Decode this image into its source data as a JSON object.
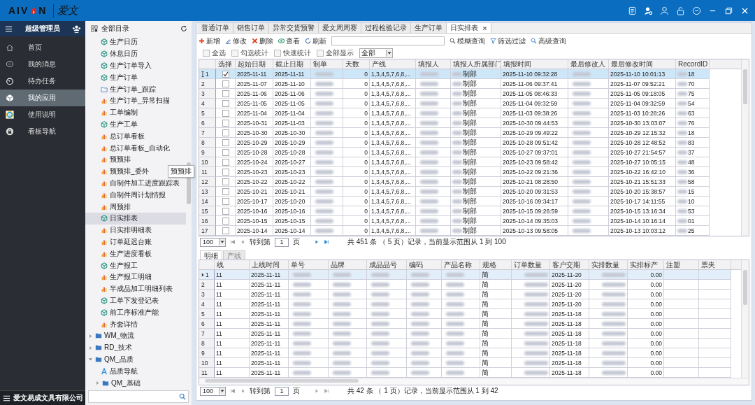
{
  "header": {
    "logo_left": "AIV",
    "logo_right": "N",
    "logo_cn": "爱文"
  },
  "sidebar": {
    "user": "超级管理员",
    "items": [
      {
        "label": "首页",
        "selected": false
      },
      {
        "label": "我的消息",
        "selected": false
      },
      {
        "label": "待办任务",
        "selected": false
      },
      {
        "label": "我的应用",
        "selected": true
      },
      {
        "label": "使用说明",
        "selected": false
      },
      {
        "label": "看板导航",
        "selected": false
      }
    ],
    "company": "爱文易成文具有限公司"
  },
  "tree": {
    "title": "全部目录",
    "items": [
      {
        "kind": "form",
        "label": "生产日历",
        "selected": false
      },
      {
        "kind": "form",
        "label": "休息日历",
        "selected": false
      },
      {
        "kind": "form",
        "label": "生产订单导入",
        "selected": false
      },
      {
        "kind": "form",
        "label": "生产订单",
        "selected": false
      },
      {
        "kind": "folder",
        "label": "生产订单_跟踪",
        "selected": false
      },
      {
        "kind": "report",
        "label": "生产订单_异常扫描",
        "selected": false
      },
      {
        "kind": "report",
        "label": "工单编制",
        "selected": false
      },
      {
        "kind": "form",
        "label": "生产工单",
        "selected": false
      },
      {
        "kind": "report",
        "label": "总订单看板",
        "selected": false
      },
      {
        "kind": "report",
        "label": "总订单看板_自动化",
        "selected": false
      },
      {
        "kind": "report",
        "label": "预预排",
        "selected": false
      },
      {
        "kind": "report",
        "label": "预预排_委外",
        "selected": false
      },
      {
        "kind": "report",
        "label": "自制件加工进度跟踪表",
        "selected": false
      },
      {
        "kind": "report",
        "label": "自制件周计划情报",
        "selected": false
      },
      {
        "kind": "report",
        "label": "周预排",
        "selected": false
      },
      {
        "kind": "form",
        "label": "日实排表",
        "selected": true
      },
      {
        "kind": "report",
        "label": "日实排明细表",
        "selected": false
      },
      {
        "kind": "report",
        "label": "订单延迟台账",
        "selected": false
      },
      {
        "kind": "report",
        "label": "生产进度看板",
        "selected": false
      },
      {
        "kind": "form",
        "label": "生产报工",
        "selected": false
      },
      {
        "kind": "report",
        "label": "生产报工明细",
        "selected": false
      },
      {
        "kind": "report",
        "label": "半成品加工明细列表",
        "selected": false
      },
      {
        "kind": "form",
        "label": "工单下发登记表",
        "selected": false
      },
      {
        "kind": "form",
        "label": "前工序标准产能",
        "selected": false
      },
      {
        "kind": "report",
        "label": "齐套详情",
        "selected": false
      }
    ],
    "folders": [
      {
        "label": "WM_物流",
        "expanded": false
      },
      {
        "label": "RD_技术",
        "expanded": false
      },
      {
        "label": "QM_品质",
        "expanded": true,
        "children": [
          {
            "kind": "navigator",
            "label": "品质导航"
          },
          {
            "kind": "folder",
            "label": "QM_基础",
            "expanded": false
          }
        ]
      }
    ]
  },
  "tooltip": "预预排",
  "tabs": [
    {
      "label": "普通订单",
      "selected": false,
      "closable": false
    },
    {
      "label": "销售订单",
      "selected": false,
      "closable": false
    },
    {
      "label": "异常交货预警",
      "selected": false,
      "closable": false
    },
    {
      "label": "爱文周周赛",
      "selected": false,
      "closable": false
    },
    {
      "label": "过程检验记录",
      "selected": false,
      "closable": false
    },
    {
      "label": "生产订单",
      "selected": false,
      "closable": false
    },
    {
      "label": "日实排表",
      "selected": true,
      "closable": true
    }
  ],
  "toolbar": {
    "actions": [
      {
        "label": "新增"
      },
      {
        "label": "修改"
      },
      {
        "label": "删除"
      },
      {
        "label": "查看"
      },
      {
        "label": "刷新"
      }
    ],
    "queries": [
      {
        "label": "模糊查询"
      },
      {
        "label": "筛选过滤"
      },
      {
        "label": "高级查询"
      }
    ]
  },
  "options": [
    {
      "label": "全选",
      "checked": false
    },
    {
      "label": "勾选统计",
      "checked": false
    },
    {
      "label": "快速统计",
      "checked": false
    },
    {
      "label": "全部显示",
      "checked": false
    }
  ],
  "filter": {
    "value": "全部"
  },
  "master": {
    "columns": [
      "选择",
      "起始日期",
      "截止日期",
      "制单",
      "天数",
      "产线",
      "填报人",
      "填报人所属部门",
      "填报时间",
      "最后修改人",
      "最后修改时间",
      "RecordID"
    ],
    "rows": [
      {
        "no": "1",
        "current": true,
        "checked": true,
        "start": "2025-11-11",
        "end": "2025-11-11",
        "days": "0",
        "line": "1,3,4,5,7,6,8,...",
        "dept": "制部",
        "filed": "2025-11-10 09:32:28",
        "modified": "2025-11-10 10:01:13",
        "record": "18"
      },
      {
        "no": "2",
        "current": false,
        "checked": false,
        "start": "2025-11-07",
        "end": "2025-11-10",
        "days": "0",
        "line": "1,3,4,5,7,6,8,...",
        "dept": "制部",
        "filed": "2025-11-06 09:37:41",
        "modified": "2025-11-07 09:52:21",
        "record": "70"
      },
      {
        "no": "3",
        "current": false,
        "checked": false,
        "start": "2025-11-06",
        "end": "2025-11-06",
        "days": "0",
        "line": "1,3,4,5,7,6,8,...",
        "dept": "制部",
        "filed": "2025-11-05 08:46:33",
        "modified": "2025-11-05 09:18:05",
        "record": "75"
      },
      {
        "no": "4",
        "current": false,
        "checked": false,
        "start": "2025-11-05",
        "end": "2025-11-05",
        "days": "0",
        "line": "1,3,4,5,7,6,8,...",
        "dept": "制部",
        "filed": "2025-11-04 09:32:59",
        "modified": "2025-11-04 09:32:59",
        "record": "54"
      },
      {
        "no": "5",
        "current": false,
        "checked": false,
        "start": "2025-11-04",
        "end": "2025-11-04",
        "days": "0",
        "line": "1,3,4,5,7,6,8,...",
        "dept": "制部",
        "filed": "2025-11-03 09:38:26",
        "modified": "2025-11-03 10:28:26",
        "record": "63"
      },
      {
        "no": "6",
        "current": false,
        "checked": false,
        "start": "2025-10-31",
        "end": "2025-11-03",
        "days": "0",
        "line": "1,3,4,5,7,6,8,...",
        "dept": "制部",
        "filed": "2025-10-30 09:44:53",
        "modified": "2025-10-30 13:03:07",
        "record": "76"
      },
      {
        "no": "7",
        "current": false,
        "checked": false,
        "start": "2025-10-30",
        "end": "2025-10-30",
        "days": "0",
        "line": "1,3,4,5,7,6,8,...",
        "dept": "制部",
        "filed": "2025-10-29 09:49:22",
        "modified": "2025-10-29 12:15:32",
        "record": "18"
      },
      {
        "no": "8",
        "current": false,
        "checked": false,
        "start": "2025-10-29",
        "end": "2025-10-29",
        "days": "0",
        "line": "1,3,4,5,7,6,8,...",
        "dept": "制部",
        "filed": "2025-10-28 09:51:42",
        "modified": "2025-10-28 12:48:52",
        "record": "83"
      },
      {
        "no": "9",
        "current": false,
        "checked": false,
        "start": "2025-10-28",
        "end": "2025-10-28",
        "days": "0",
        "line": "1,3,4,5,7,6,8,...",
        "dept": "制部",
        "filed": "2025-10-27 09:37:01",
        "modified": "2025-10-27 21:54:57",
        "record": "37"
      },
      {
        "no": "10",
        "current": false,
        "checked": false,
        "start": "2025-10-24",
        "end": "2025-10-27",
        "days": "0",
        "line": "1,3,4,5,7,6,8,...",
        "dept": "制部",
        "filed": "2025-10-23 09:58:42",
        "modified": "2025-10-27 10:05:15",
        "record": "48"
      },
      {
        "no": "11",
        "current": false,
        "checked": false,
        "start": "2025-10-23",
        "end": "2025-10-23",
        "days": "0",
        "line": "1,3,4,5,7,6,8,...",
        "dept": "制部",
        "filed": "2025-10-22 09:21:36",
        "modified": "2025-10-22 16:42:10",
        "record": "36"
      },
      {
        "no": "12",
        "current": false,
        "checked": false,
        "start": "2025-10-22",
        "end": "2025-10-22",
        "days": "0",
        "line": "1,3,4,5,7,6,8,...",
        "dept": "制部",
        "filed": "2025-10-21 08:28:50",
        "modified": "2025-10-21 15:51:33",
        "record": "58"
      },
      {
        "no": "13",
        "current": false,
        "checked": false,
        "start": "2025-10-21",
        "end": "2025-10-21",
        "days": "0",
        "line": "1,3,4,5,7,6,8,...",
        "dept": "制部",
        "filed": "2025-10-20 09:31:53",
        "modified": "2025-10-20 15:38:57",
        "record": "15"
      },
      {
        "no": "14",
        "current": false,
        "checked": false,
        "start": "2025-10-17",
        "end": "2025-10-20",
        "days": "0",
        "line": "1,3,4,5,7,6,8,...",
        "dept": "制部",
        "filed": "2025-10-16 09:34:17",
        "modified": "2025-10-17 14:11:55",
        "record": "10"
      },
      {
        "no": "15",
        "current": false,
        "checked": false,
        "start": "2025-10-16",
        "end": "2025-10-16",
        "days": "0",
        "line": "1,3,4,5,7,6,8,...",
        "dept": "制部",
        "filed": "2025-10-15 09:26:59",
        "modified": "2025-10-15 13:16:34",
        "record": "53"
      },
      {
        "no": "16",
        "current": false,
        "checked": false,
        "start": "2025-10-15",
        "end": "2025-10-15",
        "days": "0",
        "line": "1,3,4,5,7,6,8,...",
        "dept": "制部",
        "filed": "2025-10-14 09:35:03",
        "modified": "2025-10-14 10:16:14",
        "record": "01"
      },
      {
        "no": "17",
        "current": false,
        "checked": false,
        "start": "2025-10-14",
        "end": "2025-10-14",
        "days": "0",
        "line": "1,3,4,5,7,6,8,...",
        "dept": "制部",
        "filed": "2025-10-13 09:58:05",
        "modified": "2025-10-13 10:03:12",
        "record": "25"
      }
    ]
  },
  "master_pager": {
    "page_size": "100",
    "before": "转到第",
    "page": "1",
    "after": "页",
    "summary": "共 451 条 （ 5 页）记录，当前显示范围从 1 到 100",
    "has_next": true
  },
  "detail_tabs": [
    {
      "label": "明细",
      "selected": true
    },
    {
      "label": "产线",
      "selected": false
    }
  ],
  "detail": {
    "columns": [
      "线",
      "上线时间",
      "单号",
      "品牌",
      "成品品号",
      "编码",
      "产品名称",
      "规格",
      "订单数量",
      "客户交期",
      "实排数量",
      "实排标产",
      "注塑",
      "票夹"
    ],
    "rows": [
      {
        "no": "1",
        "current": true,
        "line": "11",
        "online": "2025-11-11",
        "spec": "简",
        "due": "2025-11-20",
        "std": "0.00"
      },
      {
        "no": "2",
        "current": false,
        "line": "11",
        "online": "2025-11-11",
        "spec": "简",
        "due": "2025-11-20",
        "std": "0.00"
      },
      {
        "no": "3",
        "current": false,
        "line": "11",
        "online": "2025-11-11",
        "spec": "简",
        "due": "2025-11-20",
        "std": "0.00"
      },
      {
        "no": "4",
        "current": false,
        "line": "11",
        "online": "2025-11-11",
        "spec": "简",
        "due": "2025-11-20",
        "std": "0.00"
      },
      {
        "no": "5",
        "current": false,
        "line": "11",
        "online": "2025-11-11",
        "spec": "简",
        "due": "2025-11-18",
        "std": "0.00"
      },
      {
        "no": "6",
        "current": false,
        "line": "11",
        "online": "2025-11-11",
        "spec": "简",
        "due": "2025-11-18",
        "std": "0.00"
      },
      {
        "no": "7",
        "current": false,
        "line": "11",
        "online": "2025-11-11",
        "spec": "简",
        "due": "2025-11-18",
        "std": "0.00"
      },
      {
        "no": "8",
        "current": false,
        "line": "11",
        "online": "2025-11-11",
        "spec": "简",
        "due": "2025-11-18",
        "std": "0.00"
      },
      {
        "no": "9",
        "current": false,
        "line": "11",
        "online": "2025-11-11",
        "spec": "简",
        "due": "2025-11-18",
        "std": "0.00"
      },
      {
        "no": "10",
        "current": false,
        "line": "11",
        "online": "2025-11-11",
        "spec": "简",
        "due": "2025-11-18",
        "std": "0.00"
      },
      {
        "no": "11",
        "current": false,
        "line": "11",
        "online": "2025-11-11",
        "spec": "简",
        "due": "2025-11-18",
        "std": "0.00"
      }
    ]
  },
  "detail_pager": {
    "page_size": "100",
    "before": "转到第",
    "page": "1",
    "after": "页",
    "summary": "共 42 条 （ 1 页）记录，当前显示范围从 1 到 42",
    "has_next": false
  }
}
